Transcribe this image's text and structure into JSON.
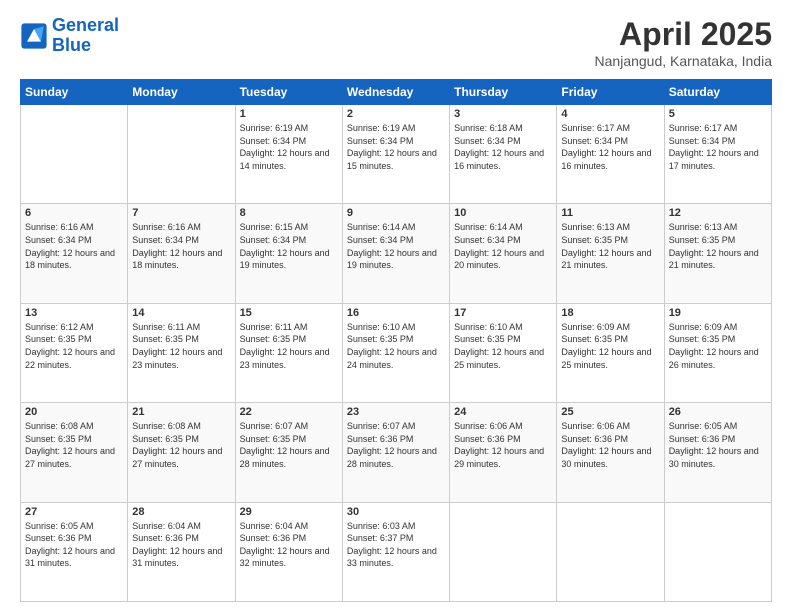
{
  "logo": {
    "line1": "General",
    "line2": "Blue"
  },
  "header": {
    "title": "April 2025",
    "subtitle": "Nanjangud, Karnataka, India"
  },
  "weekdays": [
    "Sunday",
    "Monday",
    "Tuesday",
    "Wednesday",
    "Thursday",
    "Friday",
    "Saturday"
  ],
  "weeks": [
    [
      {
        "day": "",
        "sunrise": "",
        "sunset": "",
        "daylight": ""
      },
      {
        "day": "",
        "sunrise": "",
        "sunset": "",
        "daylight": ""
      },
      {
        "day": "1",
        "sunrise": "Sunrise: 6:19 AM",
        "sunset": "Sunset: 6:34 PM",
        "daylight": "Daylight: 12 hours and 14 minutes."
      },
      {
        "day": "2",
        "sunrise": "Sunrise: 6:19 AM",
        "sunset": "Sunset: 6:34 PM",
        "daylight": "Daylight: 12 hours and 15 minutes."
      },
      {
        "day": "3",
        "sunrise": "Sunrise: 6:18 AM",
        "sunset": "Sunset: 6:34 PM",
        "daylight": "Daylight: 12 hours and 16 minutes."
      },
      {
        "day": "4",
        "sunrise": "Sunrise: 6:17 AM",
        "sunset": "Sunset: 6:34 PM",
        "daylight": "Daylight: 12 hours and 16 minutes."
      },
      {
        "day": "5",
        "sunrise": "Sunrise: 6:17 AM",
        "sunset": "Sunset: 6:34 PM",
        "daylight": "Daylight: 12 hours and 17 minutes."
      }
    ],
    [
      {
        "day": "6",
        "sunrise": "Sunrise: 6:16 AM",
        "sunset": "Sunset: 6:34 PM",
        "daylight": "Daylight: 12 hours and 18 minutes."
      },
      {
        "day": "7",
        "sunrise": "Sunrise: 6:16 AM",
        "sunset": "Sunset: 6:34 PM",
        "daylight": "Daylight: 12 hours and 18 minutes."
      },
      {
        "day": "8",
        "sunrise": "Sunrise: 6:15 AM",
        "sunset": "Sunset: 6:34 PM",
        "daylight": "Daylight: 12 hours and 19 minutes."
      },
      {
        "day": "9",
        "sunrise": "Sunrise: 6:14 AM",
        "sunset": "Sunset: 6:34 PM",
        "daylight": "Daylight: 12 hours and 19 minutes."
      },
      {
        "day": "10",
        "sunrise": "Sunrise: 6:14 AM",
        "sunset": "Sunset: 6:34 PM",
        "daylight": "Daylight: 12 hours and 20 minutes."
      },
      {
        "day": "11",
        "sunrise": "Sunrise: 6:13 AM",
        "sunset": "Sunset: 6:35 PM",
        "daylight": "Daylight: 12 hours and 21 minutes."
      },
      {
        "day": "12",
        "sunrise": "Sunrise: 6:13 AM",
        "sunset": "Sunset: 6:35 PM",
        "daylight": "Daylight: 12 hours and 21 minutes."
      }
    ],
    [
      {
        "day": "13",
        "sunrise": "Sunrise: 6:12 AM",
        "sunset": "Sunset: 6:35 PM",
        "daylight": "Daylight: 12 hours and 22 minutes."
      },
      {
        "day": "14",
        "sunrise": "Sunrise: 6:11 AM",
        "sunset": "Sunset: 6:35 PM",
        "daylight": "Daylight: 12 hours and 23 minutes."
      },
      {
        "day": "15",
        "sunrise": "Sunrise: 6:11 AM",
        "sunset": "Sunset: 6:35 PM",
        "daylight": "Daylight: 12 hours and 23 minutes."
      },
      {
        "day": "16",
        "sunrise": "Sunrise: 6:10 AM",
        "sunset": "Sunset: 6:35 PM",
        "daylight": "Daylight: 12 hours and 24 minutes."
      },
      {
        "day": "17",
        "sunrise": "Sunrise: 6:10 AM",
        "sunset": "Sunset: 6:35 PM",
        "daylight": "Daylight: 12 hours and 25 minutes."
      },
      {
        "day": "18",
        "sunrise": "Sunrise: 6:09 AM",
        "sunset": "Sunset: 6:35 PM",
        "daylight": "Daylight: 12 hours and 25 minutes."
      },
      {
        "day": "19",
        "sunrise": "Sunrise: 6:09 AM",
        "sunset": "Sunset: 6:35 PM",
        "daylight": "Daylight: 12 hours and 26 minutes."
      }
    ],
    [
      {
        "day": "20",
        "sunrise": "Sunrise: 6:08 AM",
        "sunset": "Sunset: 6:35 PM",
        "daylight": "Daylight: 12 hours and 27 minutes."
      },
      {
        "day": "21",
        "sunrise": "Sunrise: 6:08 AM",
        "sunset": "Sunset: 6:35 PM",
        "daylight": "Daylight: 12 hours and 27 minutes."
      },
      {
        "day": "22",
        "sunrise": "Sunrise: 6:07 AM",
        "sunset": "Sunset: 6:35 PM",
        "daylight": "Daylight: 12 hours and 28 minutes."
      },
      {
        "day": "23",
        "sunrise": "Sunrise: 6:07 AM",
        "sunset": "Sunset: 6:36 PM",
        "daylight": "Daylight: 12 hours and 28 minutes."
      },
      {
        "day": "24",
        "sunrise": "Sunrise: 6:06 AM",
        "sunset": "Sunset: 6:36 PM",
        "daylight": "Daylight: 12 hours and 29 minutes."
      },
      {
        "day": "25",
        "sunrise": "Sunrise: 6:06 AM",
        "sunset": "Sunset: 6:36 PM",
        "daylight": "Daylight: 12 hours and 30 minutes."
      },
      {
        "day": "26",
        "sunrise": "Sunrise: 6:05 AM",
        "sunset": "Sunset: 6:36 PM",
        "daylight": "Daylight: 12 hours and 30 minutes."
      }
    ],
    [
      {
        "day": "27",
        "sunrise": "Sunrise: 6:05 AM",
        "sunset": "Sunset: 6:36 PM",
        "daylight": "Daylight: 12 hours and 31 minutes."
      },
      {
        "day": "28",
        "sunrise": "Sunrise: 6:04 AM",
        "sunset": "Sunset: 6:36 PM",
        "daylight": "Daylight: 12 hours and 31 minutes."
      },
      {
        "day": "29",
        "sunrise": "Sunrise: 6:04 AM",
        "sunset": "Sunset: 6:36 PM",
        "daylight": "Daylight: 12 hours and 32 minutes."
      },
      {
        "day": "30",
        "sunrise": "Sunrise: 6:03 AM",
        "sunset": "Sunset: 6:37 PM",
        "daylight": "Daylight: 12 hours and 33 minutes."
      },
      {
        "day": "",
        "sunrise": "",
        "sunset": "",
        "daylight": ""
      },
      {
        "day": "",
        "sunrise": "",
        "sunset": "",
        "daylight": ""
      },
      {
        "day": "",
        "sunrise": "",
        "sunset": "",
        "daylight": ""
      }
    ]
  ]
}
